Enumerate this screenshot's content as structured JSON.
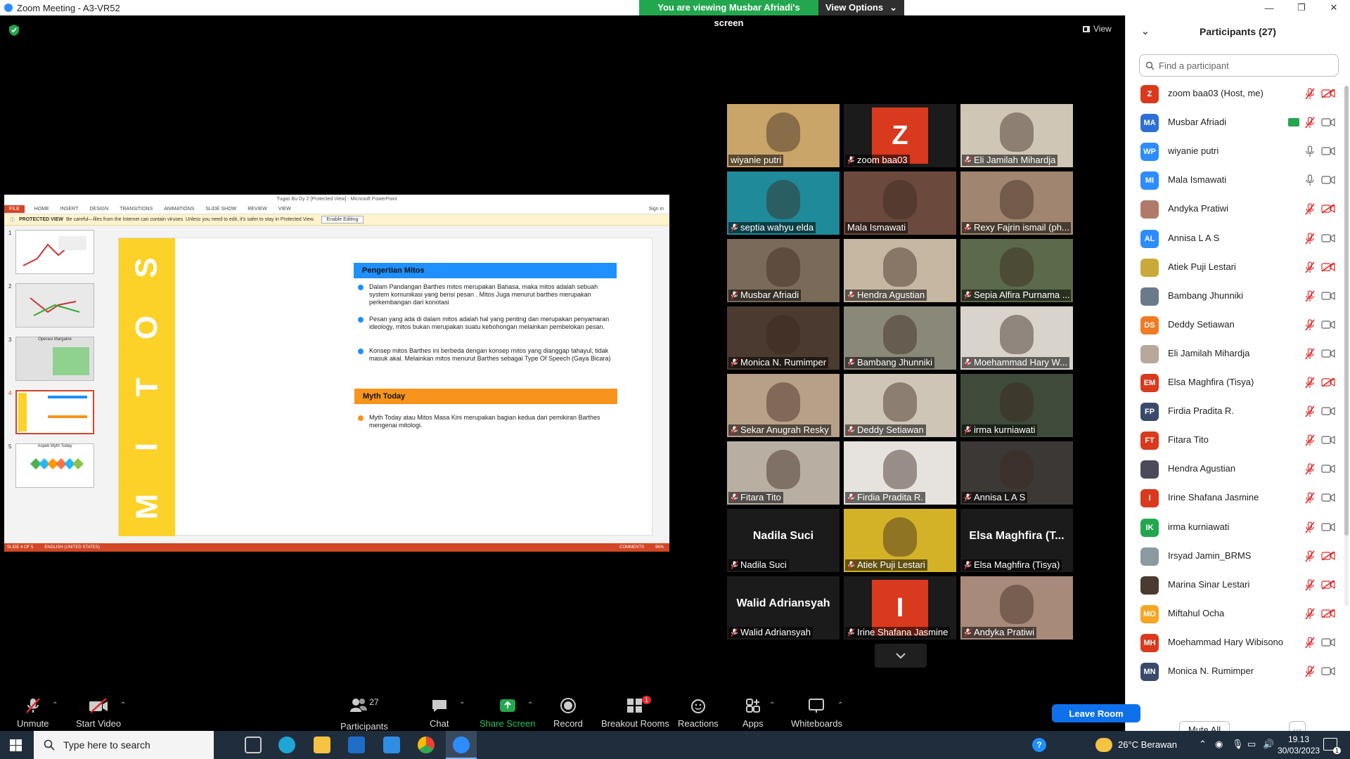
{
  "window": {
    "title": "Zoom Meeting - A3-VR52"
  },
  "share_banner": {
    "text": "You are viewing Musbar Afriadi's screen",
    "options": "View Options"
  },
  "view_button": "View",
  "ppt": {
    "title": "Tugas Bu Dy 2 [Protected View] - Microsoft PowerPoint",
    "tabs": [
      "FILE",
      "HOME",
      "INSERT",
      "DESIGN",
      "TRANSITIONS",
      "ANIMATIONS",
      "SLIDE SHOW",
      "REVIEW",
      "VIEW"
    ],
    "sign_in": "Sign in",
    "protected_label": "PROTECTED VIEW",
    "protected_text": "Be careful—files from the Internet can contain viruses. Unless you need to edit, it's safer to stay in Protected View.",
    "enable": "Enable Editing",
    "thumb_titles": [
      "Operasi Margaine",
      "Aspek Myth Today"
    ],
    "thumb_numbers": [
      "1",
      "2",
      "3",
      "4",
      "5"
    ],
    "slide_band_letters": [
      "S",
      "O",
      "T",
      "I",
      "M"
    ],
    "section1": "Pengertian Mitos",
    "bullets1": [
      "Dalam Pandangan Barthes  mitos merupakan Bahasa, maka mitos adalah sebuah system komunikasi yang berisi pesan . Mitos Juga menurut barthes merupakan perkembangan dari konotasi",
      "Pesan yang ada di dalam mitos adalah hal yang penting dan merupakan penyamaran ideology, mitos bukan merupakan suatu kebohongan melainkan pembelokan pesan.",
      "Konsep mitos Barthes ini berbeda dengan konsep  mitos yang dianggap tahayul, tidak masuk akal. Melainkan mitos menurut Barthes sebagai Type Of Speech (Gaya Bicara)"
    ],
    "section2": "Myth Today",
    "bullets2": [
      "Myth Today atau Mitos Masa Kini merupakan bagian kedua  dari pemikiran Barthes mengenai mitologi."
    ],
    "status": {
      "slide": "SLIDE 4 OF 5",
      "lang": "ENGLISH (UNITED STATES)",
      "comments": "COMMENTS",
      "zoom": "96%"
    }
  },
  "tiles": [
    {
      "name": "wiyanie putri",
      "muted": false,
      "active": true,
      "bg": "#c9a56a"
    },
    {
      "name": "zoom baa03",
      "muted": true,
      "initial": "Z"
    },
    {
      "name": "Eli Jamilah Mihardja",
      "muted": true,
      "bg": "#cfc6b5"
    },
    {
      "name": "septia wahyu elda",
      "muted": true,
      "bg": "#1e8a9a"
    },
    {
      "name": "Mala Ismawati",
      "muted": false,
      "bg": "#6b4a3d"
    },
    {
      "name": "Rexy Fajrin ismail (ph...",
      "muted": true,
      "bg": "#a08570"
    },
    {
      "name": "Musbar Afriadi",
      "muted": true,
      "bg": "#7a6a5a"
    },
    {
      "name": "Hendra Agustian",
      "muted": true,
      "bg": "#c6b7a3"
    },
    {
      "name": "Sepia Alfira Purnama ...",
      "muted": true,
      "bg": "#5a6a4a"
    },
    {
      "name": "Monica N. Rumimper",
      "muted": true,
      "bg": "#4a3a30"
    },
    {
      "name": "Bambang Jhunniki",
      "muted": true,
      "bg": "#8a8878"
    },
    {
      "name": "Moehammad Hary W...",
      "muted": true,
      "bg": "#d8d4cc"
    },
    {
      "name": "Sekar Anugrah Resky",
      "muted": true,
      "bg": "#b89f88"
    },
    {
      "name": "Deddy Setiawan",
      "muted": true,
      "bg": "#cfc5b6"
    },
    {
      "name": "irma kurniawati",
      "muted": true,
      "bg": "#3e4a3a"
    },
    {
      "name": "Fitara Tito",
      "muted": true,
      "bg": "#b8aea2"
    },
    {
      "name": "Firdia Pradita R.",
      "muted": true,
      "bg": "#e6e2dd"
    },
    {
      "name": "Annisa L A S",
      "muted": true,
      "bg": "#3c3836"
    },
    {
      "name": "Nadila Suci",
      "muted": true,
      "big": "Nadila Suci"
    },
    {
      "name": "Atiek Puji Lestari",
      "muted": true,
      "bg": "#d4b228"
    },
    {
      "name": "Elsa Maghfira (Tisya)",
      "muted": true,
      "big": "Elsa Maghfira (T..."
    },
    {
      "name": "Walid Adriansyah",
      "muted": true,
      "big": "Walid Adriansyah"
    },
    {
      "name": "Irine Shafana Jasmine",
      "muted": true,
      "initial": "I"
    },
    {
      "name": "Andyka Pratiwi",
      "muted": true,
      "bg": "#a88a7a"
    }
  ],
  "participants_panel": {
    "title": "Participants (27)",
    "search_placeholder": "Find a participant",
    "mute_all": "Mute All",
    "more": "···",
    "list": [
      {
        "initials": "Z",
        "name": "zoom baa03 (Host, me)",
        "color": "#d9391d",
        "mic": "muted",
        "cam": "off"
      },
      {
        "initials": "MA",
        "name": "Musbar Afriadi",
        "color": "#2d6fd6",
        "mic": "muted",
        "cam": "on",
        "sharing": true
      },
      {
        "initials": "WP",
        "name": "wiyanie putri",
        "color": "#2d8cff",
        "mic": "on",
        "cam": "on"
      },
      {
        "initials": "MI",
        "name": "Mala Ismawati",
        "color": "#2d8cff",
        "mic": "on",
        "cam": "on"
      },
      {
        "initials": "",
        "name": "Andyka Pratiwi",
        "color": "#b07a6a",
        "mic": "muted",
        "cam": "off"
      },
      {
        "initials": "AL",
        "name": "Annisa L A S",
        "color": "#2d8cff",
        "mic": "muted",
        "cam": "on"
      },
      {
        "initials": "",
        "name": "Atiek Puji Lestari",
        "color": "#c9a93a",
        "mic": "muted",
        "cam": "off"
      },
      {
        "initials": "",
        "name": "Bambang Jhunniki",
        "color": "#6a7a8a",
        "mic": "muted",
        "cam": "on"
      },
      {
        "initials": "DS",
        "name": "Deddy Setiawan",
        "color": "#ef7b23",
        "mic": "muted",
        "cam": "on"
      },
      {
        "initials": "",
        "name": "Eli Jamilah Mihardja",
        "color": "#b8a89a",
        "mic": "muted",
        "cam": "on"
      },
      {
        "initials": "EM",
        "name": "Elsa Maghfira (Tisya)",
        "color": "#d9391d",
        "mic": "muted",
        "cam": "off"
      },
      {
        "initials": "FP",
        "name": "Firdia Pradita R.",
        "color": "#3a4a6a",
        "mic": "muted",
        "cam": "on"
      },
      {
        "initials": "FT",
        "name": "Fitara Tito",
        "color": "#d9391d",
        "mic": "muted",
        "cam": "on"
      },
      {
        "initials": "",
        "name": "Hendra Agustian",
        "color": "#4a4a5a",
        "mic": "muted",
        "cam": "on"
      },
      {
        "initials": "I",
        "name": "Irine Shafana Jasmine",
        "color": "#d9391d",
        "mic": "muted",
        "cam": "on"
      },
      {
        "initials": "IK",
        "name": "irma kurniawati",
        "color": "#23a74e",
        "mic": "muted",
        "cam": "on"
      },
      {
        "initials": "",
        "name": "Irsyad Jamin_BRMS",
        "color": "#8a9aa0",
        "mic": "muted",
        "cam": "off"
      },
      {
        "initials": "",
        "name": "Marina Sinar Lestari",
        "color": "#4a3a30",
        "mic": "muted",
        "cam": "off"
      },
      {
        "initials": "MO",
        "name": "Miftahul Ocha",
        "color": "#f5a623",
        "mic": "muted",
        "cam": "off"
      },
      {
        "initials": "MH",
        "name": "Moehammad Hary Wibisono",
        "color": "#d9391d",
        "mic": "muted",
        "cam": "on"
      },
      {
        "initials": "MN",
        "name": "Monica N. Rumimper",
        "color": "#3a4a6a",
        "mic": "muted",
        "cam": "on"
      }
    ]
  },
  "toolbar": {
    "unmute": "Unmute",
    "start_video": "Start Video",
    "participants": "Participants",
    "participants_count": "27",
    "chat": "Chat",
    "share": "Share Screen",
    "record": "Record",
    "breakout": "Breakout Rooms",
    "breakout_badge": "1",
    "reactions": "Reactions",
    "apps": "Apps",
    "whiteboards": "Whiteboards",
    "leave": "Leave Room"
  },
  "taskbar": {
    "search": "Type here to search",
    "weather": "26°C  Berawan",
    "time": "19.13",
    "date": "30/03/2023",
    "notif": "1"
  },
  "colors": {
    "accent_green": "#23a74e",
    "zoom_blue": "#0e71eb",
    "ppt_red": "#d24726",
    "slide_yellow": "#fcd229",
    "slide_blue": "#1e90ff",
    "slide_orange": "#f7941d"
  }
}
